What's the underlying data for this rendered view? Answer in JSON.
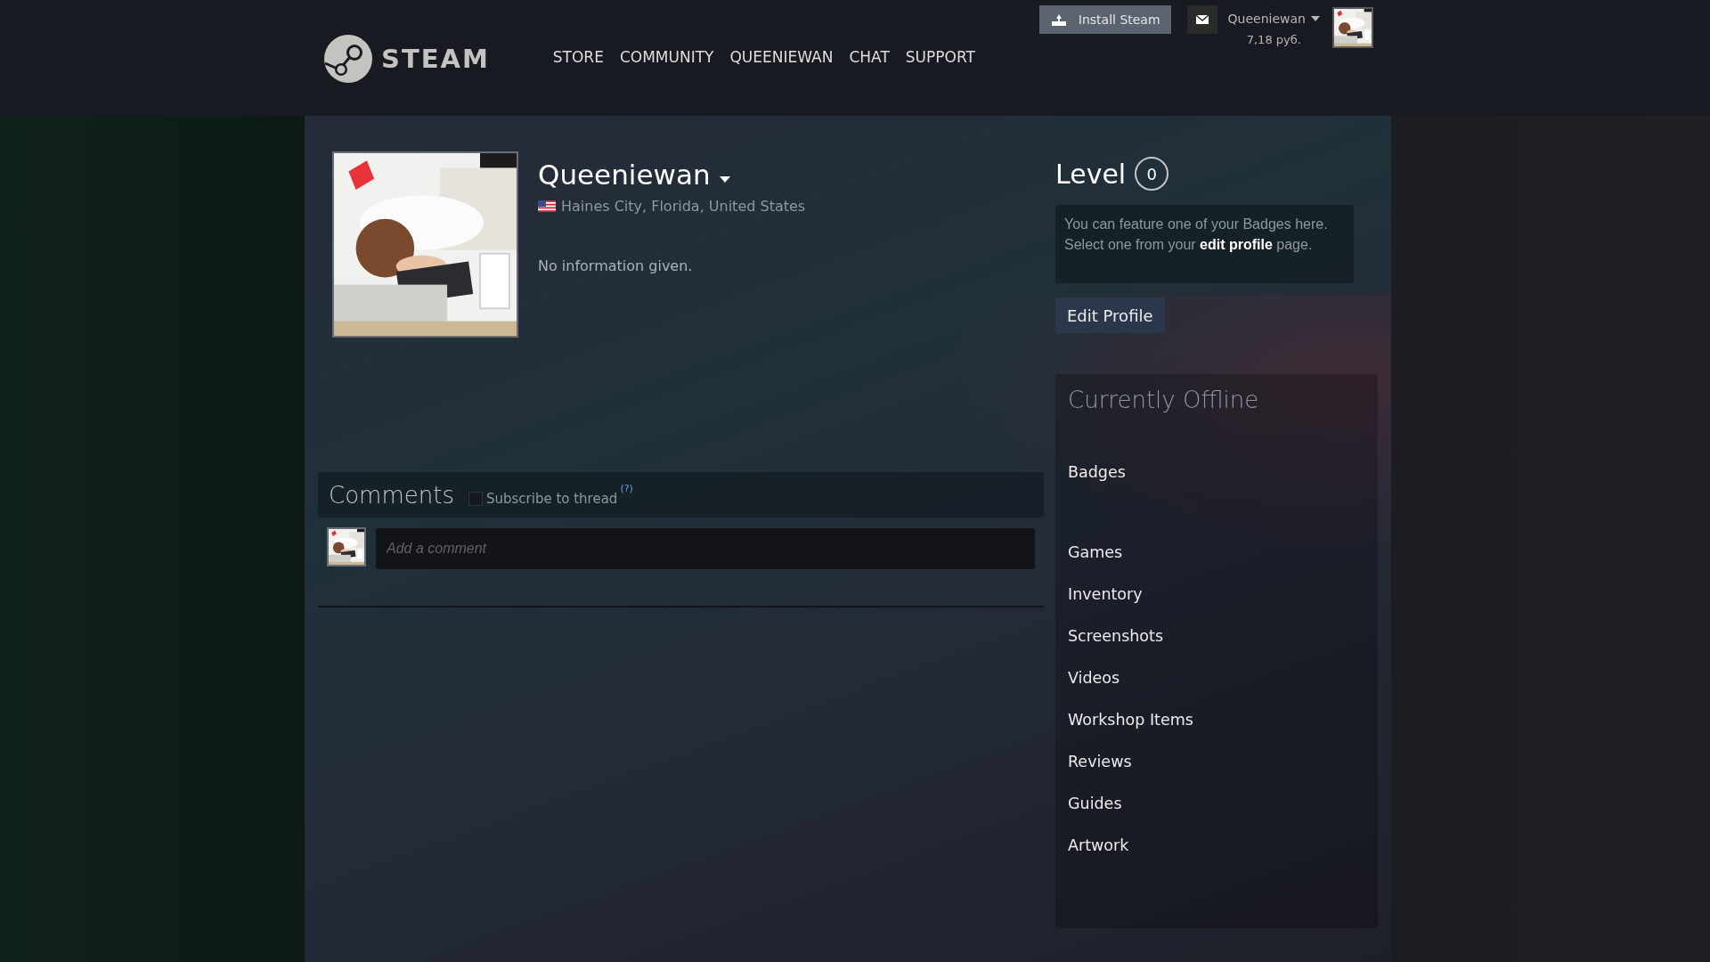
{
  "header": {
    "logo_text": "STEAM",
    "nav": [
      {
        "label": "STORE"
      },
      {
        "label": "COMMUNITY"
      },
      {
        "label": "QUEENIEWAN"
      },
      {
        "label": "CHAT"
      },
      {
        "label": "SUPPORT"
      }
    ],
    "install_button": "Install Steam",
    "account_name": "Queeniewan",
    "wallet": "7,18 руб."
  },
  "profile": {
    "name": "Queeniewan",
    "location": "Haines City, Florida, United States",
    "summary": "No information given."
  },
  "level": {
    "label": "Level",
    "value": "0",
    "badge_hint": "You can feature one of your Badges here. Select one from your **edit profile** page.",
    "edit_button": "Edit Profile"
  },
  "comments": {
    "title": "Comments",
    "subscribe": {
      "label": "Subscribe to thread",
      "checked": false
    },
    "help_mark": "(?)",
    "placeholder": "Add a comment"
  },
  "sidebar": {
    "status": "Currently Offline",
    "badges_link": "Badges",
    "links": [
      {
        "label": "Games"
      },
      {
        "label": "Inventory"
      },
      {
        "label": "Screenshots"
      },
      {
        "label": "Videos"
      },
      {
        "label": "Workshop Items"
      },
      {
        "label": "Reviews"
      },
      {
        "label": "Guides"
      },
      {
        "label": "Artwork"
      }
    ]
  }
}
